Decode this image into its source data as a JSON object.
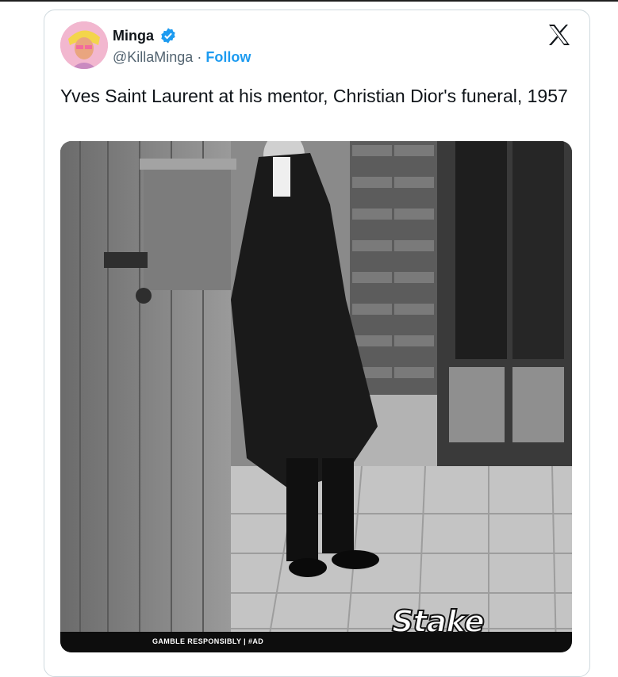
{
  "author": {
    "name": "Minga",
    "handle": "@KillaMinga",
    "separator": "·",
    "follow_label": "Follow",
    "verified": true,
    "verified_color": "#1d9bf0"
  },
  "post": {
    "text": "Yves Saint Laurent at his mentor, Christian Dior's funeral, 1957"
  },
  "media": {
    "banner_text": "GAMBLE RESPONSIBLY | #AD",
    "logo_text": "Stake"
  },
  "icons": [
    "verified-badge-icon",
    "x-logo-icon"
  ],
  "colors": {
    "accent": "#1d9bf0",
    "text": "#0f1419",
    "muted": "#536471",
    "border": "#cfd9de"
  }
}
